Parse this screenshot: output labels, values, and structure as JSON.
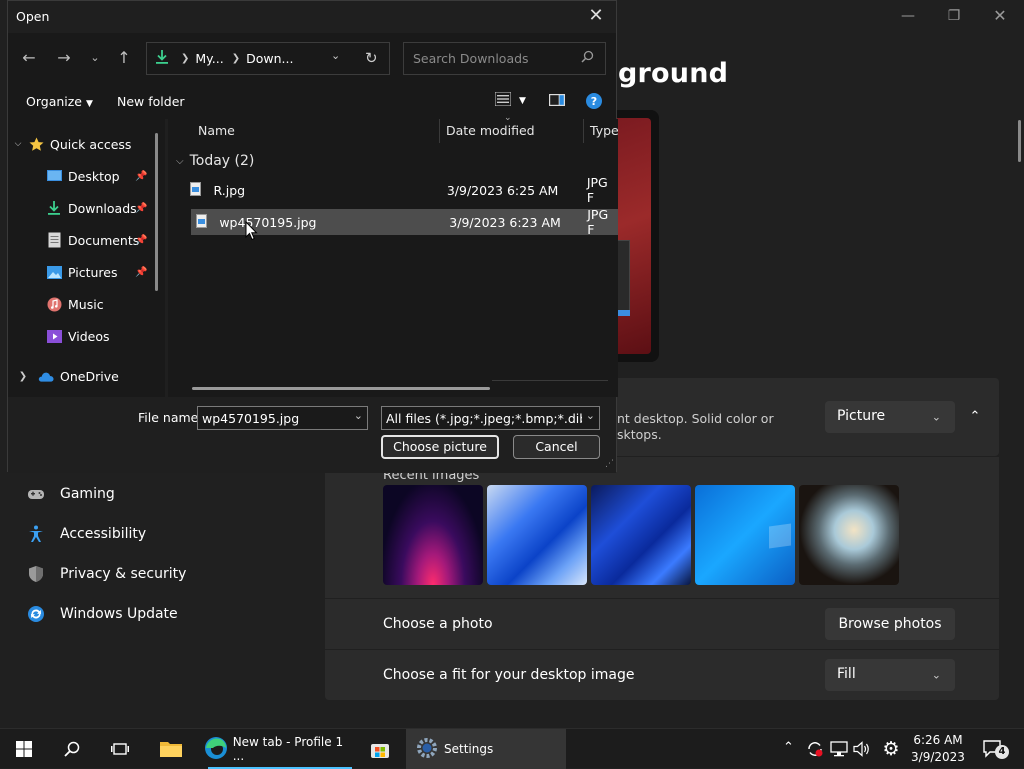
{
  "settings": {
    "title_partial": "ground",
    "background_desc": "nt desktop. Solid color or",
    "background_desc2": "sktops.",
    "background_type": "Picture",
    "recent_images_label": "Recent images",
    "choose_photo_label": "Choose a photo",
    "browse_photos_label": "Browse photos",
    "fit_label": "Choose a fit for your desktop image",
    "fit_value": "Fill",
    "nav": [
      {
        "label": "Gaming",
        "icon": "gamepad-icon"
      },
      {
        "label": "Accessibility",
        "icon": "accessibility-icon"
      },
      {
        "label": "Privacy & security",
        "icon": "shield-icon"
      },
      {
        "label": "Windows Update",
        "icon": "windows-update-icon"
      }
    ]
  },
  "dialog": {
    "title": "Open",
    "breadcrumb": [
      "My...",
      "Down..."
    ],
    "search_placeholder": "Search Downloads",
    "organize_label": "Organize",
    "new_folder_label": "New folder",
    "nav_pane": [
      {
        "label": "Quick access",
        "icon": "star-icon"
      },
      {
        "label": "Desktop",
        "icon": "desktop-icon",
        "pinned": true
      },
      {
        "label": "Downloads",
        "icon": "download-icon",
        "pinned": true
      },
      {
        "label": "Documents",
        "icon": "document-icon",
        "pinned": true
      },
      {
        "label": "Pictures",
        "icon": "pictures-icon",
        "pinned": true
      },
      {
        "label": "Music",
        "icon": "music-icon"
      },
      {
        "label": "Videos",
        "icon": "videos-icon"
      },
      {
        "label": "OneDrive",
        "icon": "cloud-icon"
      }
    ],
    "columns": {
      "name": "Name",
      "date": "Date modified",
      "type": "Type"
    },
    "group_label": "Today (2)",
    "files": [
      {
        "name": "R.jpg",
        "date": "3/9/2023 6:25 AM",
        "type": "JPG F"
      },
      {
        "name": "wp4570195.jpg",
        "date": "3/9/2023 6:23 AM",
        "type": "JPG F"
      }
    ],
    "file_name_label": "File name:",
    "file_name_value": "wp4570195.jpg",
    "file_type_value": "All files (*.jpg;*.jpeg;*.bmp;*.dib;*.png",
    "choose_button": "Choose picture",
    "cancel_button": "Cancel"
  },
  "taskbar": {
    "edge_label": "New tab - Profile 1 ...",
    "settings_label": "Settings",
    "time": "6:26 AM",
    "date": "3/9/2023",
    "notification_count": "4"
  },
  "colors": {
    "accent": "#4cc2ff",
    "selected_row": "#4d4d4d"
  }
}
